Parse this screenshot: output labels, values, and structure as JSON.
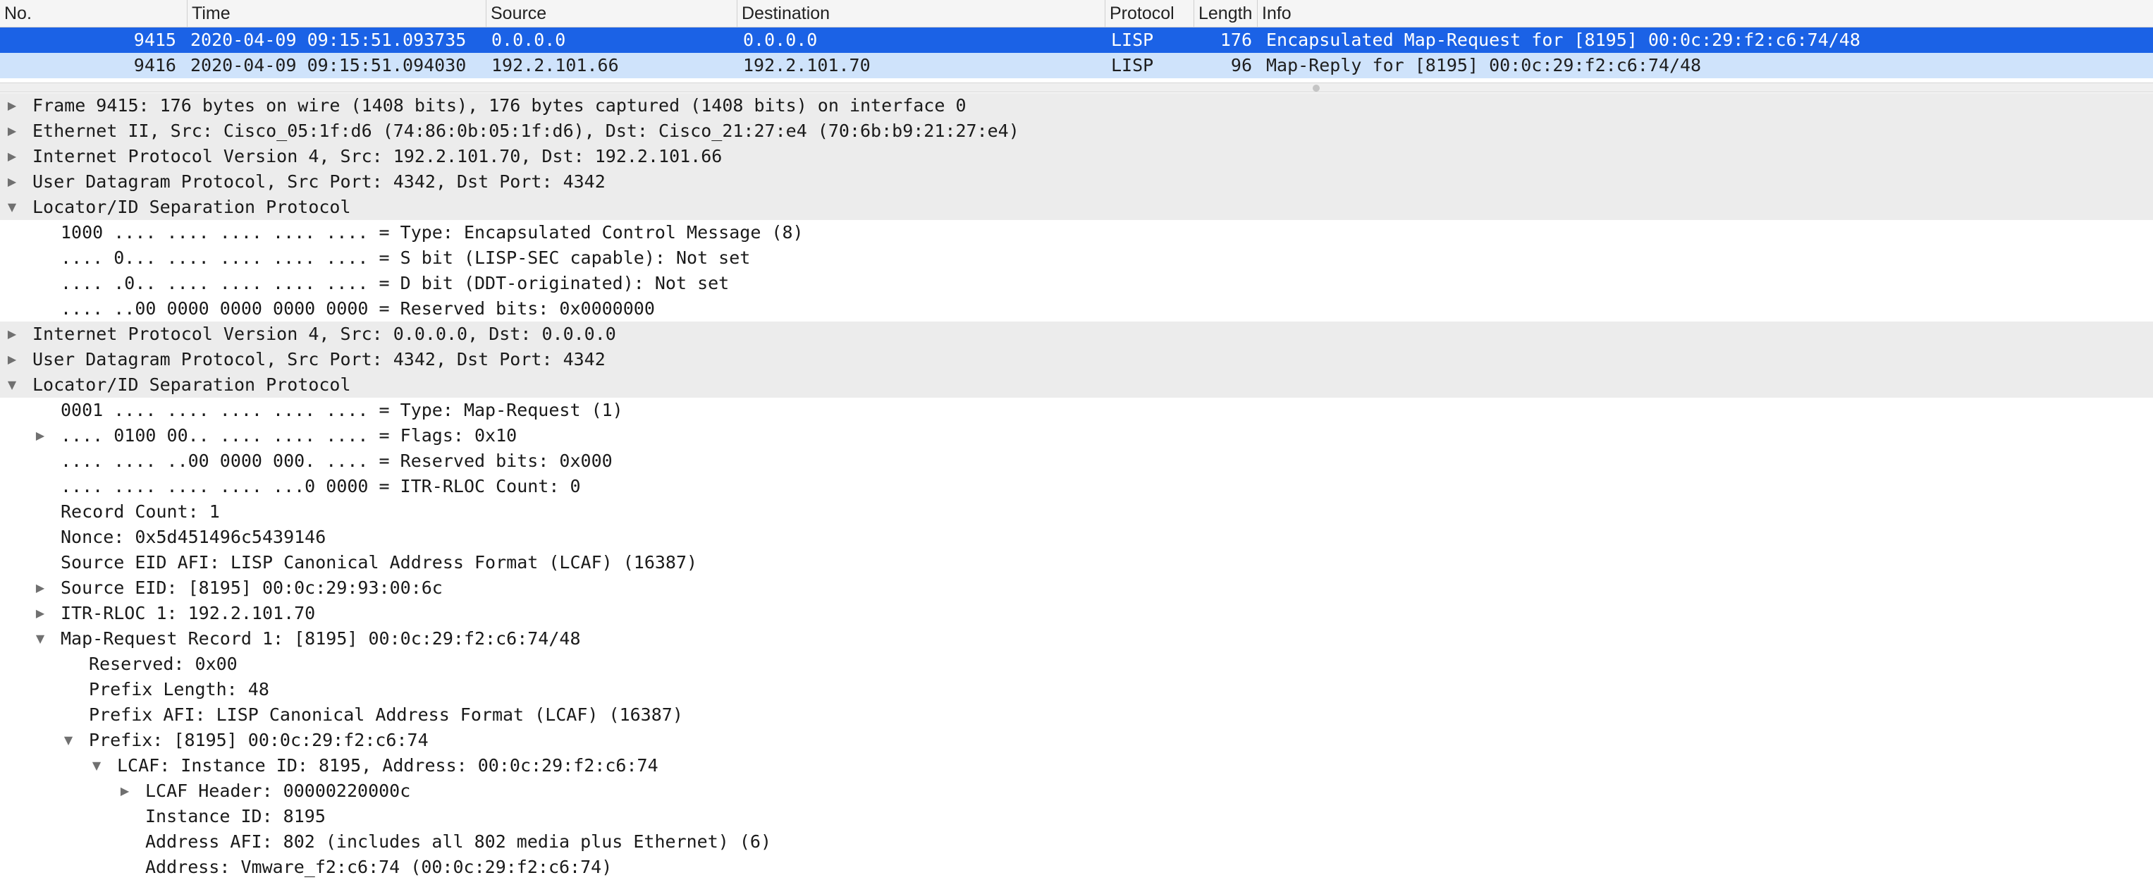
{
  "columns": {
    "no": "No.",
    "time": "Time",
    "source": "Source",
    "destination": "Destination",
    "protocol": "Protocol",
    "length": "Length",
    "info": "Info"
  },
  "packets": [
    {
      "no": "9415",
      "time": "2020-04-09 09:15:51.093735",
      "source": "0.0.0.0",
      "destination": "0.0.0.0",
      "protocol": "LISP",
      "length": "176",
      "info": "Encapsulated Map-Request for [8195] 00:0c:29:f2:c6:74/48"
    },
    {
      "no": "9416",
      "time": "2020-04-09 09:15:51.094030",
      "source": "192.2.101.66",
      "destination": "192.2.101.70",
      "protocol": "LISP",
      "length": "96",
      "info": "Map-Reply for [8195] 00:0c:29:f2:c6:74/48"
    }
  ],
  "details": [
    "Frame 9415: 176 bytes on wire (1408 bits), 176 bytes captured (1408 bits) on interface 0",
    "Ethernet II, Src: Cisco_05:1f:d6 (74:86:0b:05:1f:d6), Dst: Cisco_21:27:e4 (70:6b:b9:21:27:e4)",
    "Internet Protocol Version 4, Src: 192.2.101.70, Dst: 192.2.101.66",
    "User Datagram Protocol, Src Port: 4342, Dst Port: 4342",
    "Locator/ID Separation Protocol",
    "1000 .... .... .... .... .... = Type: Encapsulated Control Message (8)",
    ".... 0... .... .... .... .... = S bit (LISP-SEC capable): Not set",
    ".... .0.. .... .... .... .... = D bit (DDT-originated): Not set",
    ".... ..00 0000 0000 0000 0000 = Reserved bits: 0x0000000",
    "Internet Protocol Version 4, Src: 0.0.0.0, Dst: 0.0.0.0",
    "User Datagram Protocol, Src Port: 4342, Dst Port: 4342",
    "Locator/ID Separation Protocol",
    "0001 .... .... .... .... .... = Type: Map-Request (1)",
    ".... 0100 00.. .... .... .... = Flags: 0x10",
    ".... .... ..00 0000 000. .... = Reserved bits: 0x000",
    ".... .... .... .... ...0 0000 = ITR-RLOC Count: 0",
    "Record Count: 1",
    "Nonce: 0x5d451496c5439146",
    "Source EID AFI: LISP Canonical Address Format (LCAF) (16387)",
    "Source EID: [8195] 00:0c:29:93:00:6c",
    "ITR-RLOC 1: 192.2.101.70",
    "Map-Request Record 1: [8195] 00:0c:29:f2:c6:74/48",
    "Reserved: 0x00",
    "Prefix Length: 48",
    "Prefix AFI: LISP Canonical Address Format (LCAF) (16387)",
    "Prefix: [8195] 00:0c:29:f2:c6:74",
    "LCAF: Instance ID: 8195, Address: 00:0c:29:f2:c6:74",
    "LCAF Header: 00000220000c",
    "Instance ID: 8195",
    "Address AFI: 802 (includes all 802 media plus Ethernet) (6)",
    "Address: Vmware_f2:c6:74 (00:0c:29:f2:c6:74)"
  ],
  "icons": {
    "collapsed": "▶",
    "expanded": "▼"
  }
}
